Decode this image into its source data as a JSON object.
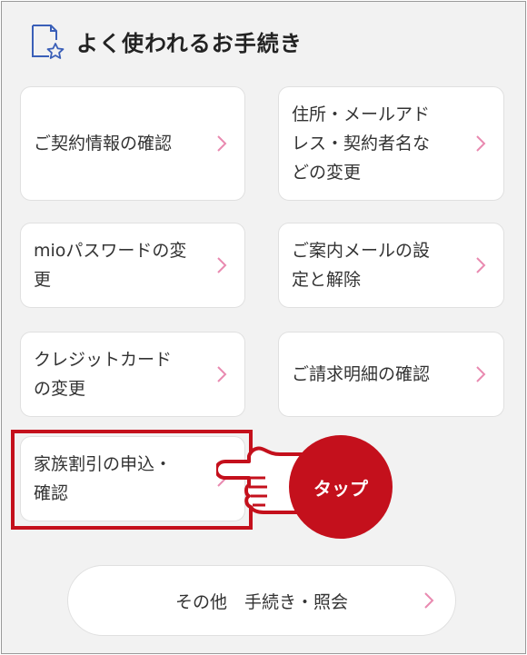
{
  "header": {
    "title": "よく使われるお手続き"
  },
  "cards": [
    {
      "lines": [
        "ご契約情報の確認"
      ]
    },
    {
      "lines": [
        "住所・メールアド",
        "レス・契約者名な",
        "どの変更"
      ]
    },
    {
      "lines": [
        "mioパスワードの変",
        "更"
      ]
    },
    {
      "lines": [
        "ご案内メールの設",
        "定と解除"
      ]
    },
    {
      "lines": [
        "クレジットカード",
        "の変更"
      ]
    },
    {
      "lines": [
        "ご請求明細の確認"
      ]
    },
    {
      "lines": [
        "家族割引の申込・",
        "確認"
      ]
    }
  ],
  "other_button": {
    "label": "その他　手続き・照会"
  },
  "tap_label": "タップ",
  "colors": {
    "accent_red": "#c4101c",
    "chevron_pink": "#e98ab0",
    "icon_blue": "#3a5fb8"
  }
}
